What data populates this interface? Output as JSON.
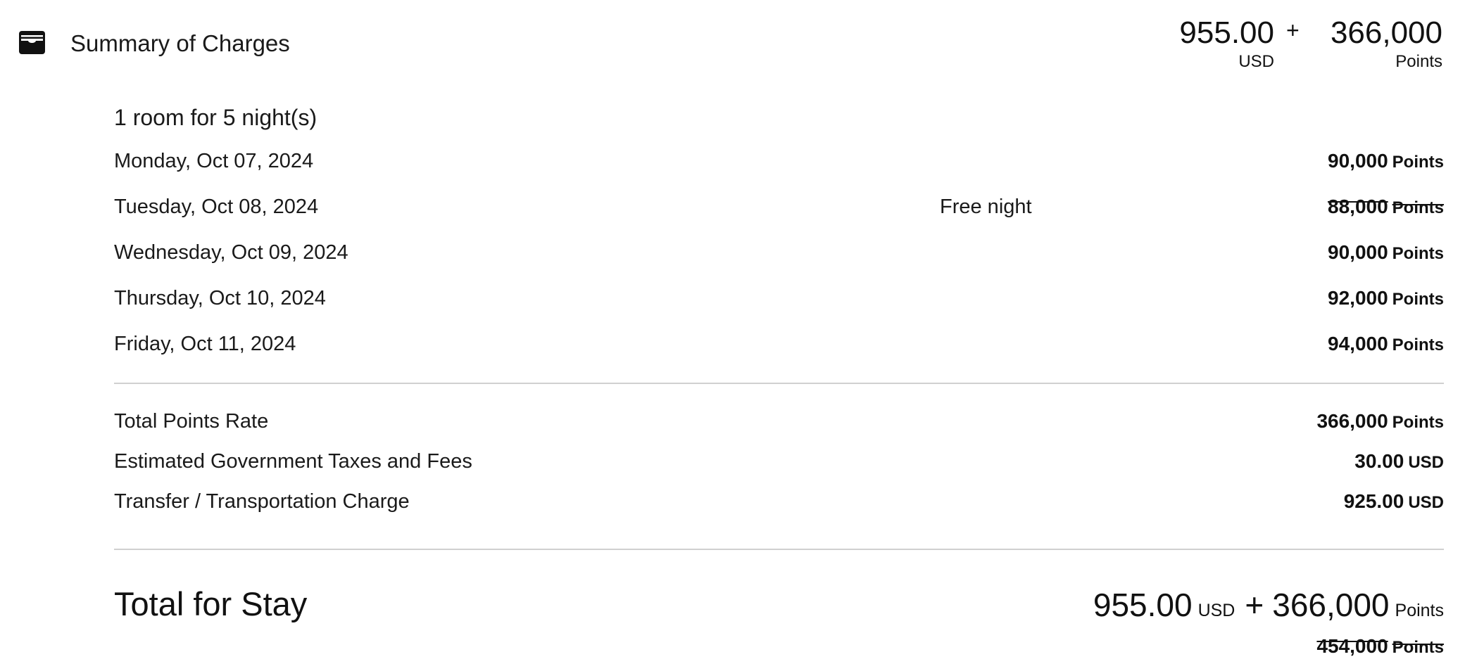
{
  "header": {
    "icon": "wallet-icon",
    "title": "Summary of Charges",
    "cash_amount": "955.00",
    "cash_unit": "USD",
    "plus": "+",
    "points_amount": "366,000",
    "points_unit": "Points"
  },
  "stay": {
    "heading": "1 room for 5 night(s)",
    "nights": [
      {
        "date": "Monday, Oct 07, 2024",
        "note": "",
        "amount": "90,000",
        "unit": "Points",
        "struck": false
      },
      {
        "date": "Tuesday, Oct 08, 2024",
        "note": "Free night",
        "amount": "88,000",
        "unit": "Points",
        "struck": true
      },
      {
        "date": "Wednesday, Oct 09, 2024",
        "note": "",
        "amount": "90,000",
        "unit": "Points",
        "struck": false
      },
      {
        "date": "Thursday, Oct 10, 2024",
        "note": "",
        "amount": "92,000",
        "unit": "Points",
        "struck": false
      },
      {
        "date": "Friday, Oct 11, 2024",
        "note": "",
        "amount": "94,000",
        "unit": "Points",
        "struck": false
      }
    ]
  },
  "charges": [
    {
      "label": "Total Points Rate",
      "amount": "366,000",
      "unit": "Points"
    },
    {
      "label": "Estimated Government Taxes and Fees",
      "amount": "30.00",
      "unit": "USD"
    },
    {
      "label": "Transfer / Transportation Charge",
      "amount": "925.00",
      "unit": "USD"
    }
  ],
  "total": {
    "label": "Total for Stay",
    "cash_amount": "955.00",
    "cash_unit": "USD",
    "plus": "+",
    "points_amount": "366,000",
    "points_unit": "Points",
    "original_points_amount": "454,000",
    "original_points_unit": "Points"
  }
}
